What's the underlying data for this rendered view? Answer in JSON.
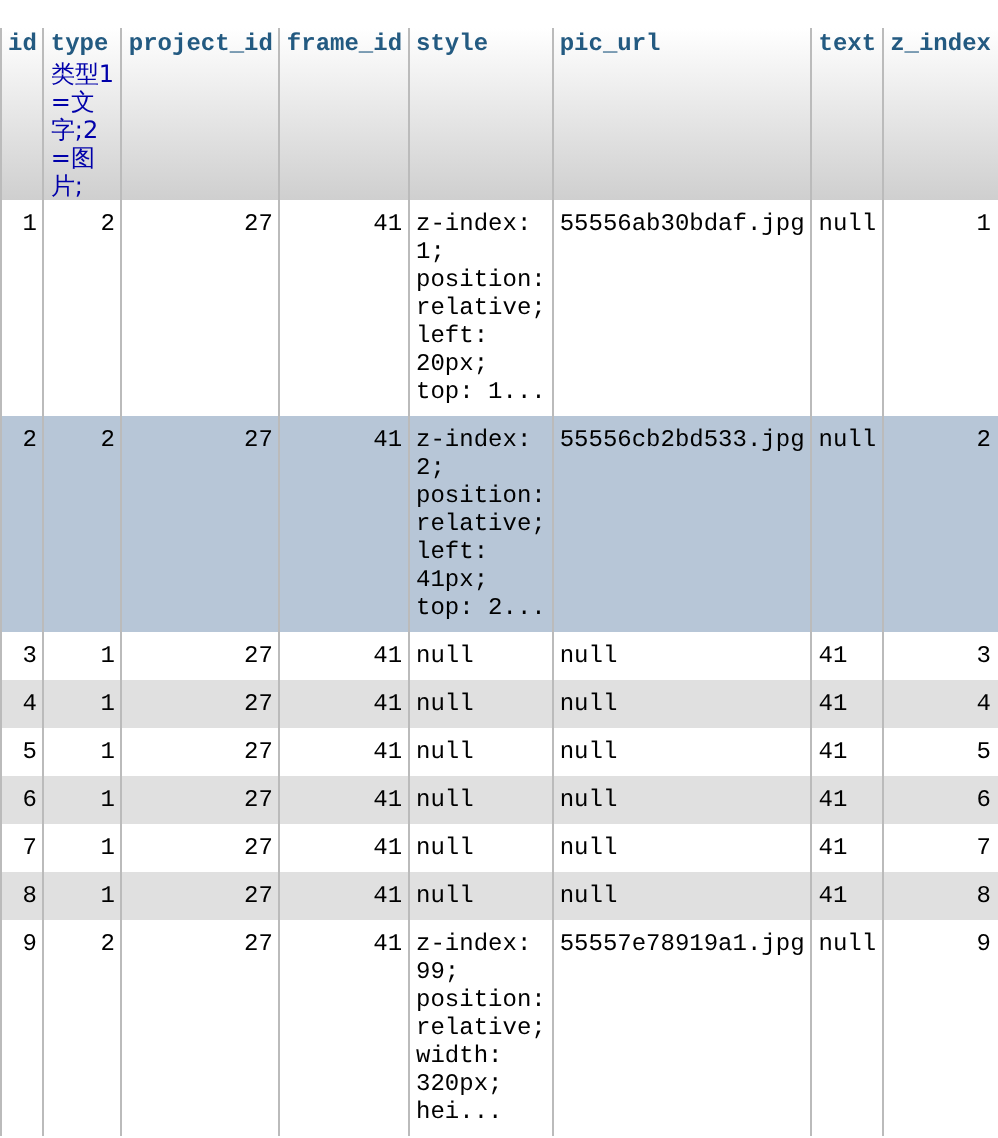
{
  "table": {
    "columns": [
      {
        "name": "id"
      },
      {
        "name": "type",
        "comment": "类型1=文字;2=图片;"
      },
      {
        "name": "project_id"
      },
      {
        "name": "frame_id"
      },
      {
        "name": "style"
      },
      {
        "name": "pic_url"
      },
      {
        "name": "text"
      },
      {
        "name": "z_index"
      }
    ],
    "rows": [
      {
        "selected": false,
        "cells": [
          "1",
          "2",
          "27",
          "41",
          "z-index: 1; position: relative; left: 20px; top: 1...",
          "55556ab30bdaf.jpg",
          "null",
          "1"
        ]
      },
      {
        "selected": true,
        "cells": [
          "2",
          "2",
          "27",
          "41",
          "z-index: 2; position: relative; left: 41px; top: 2...",
          "55556cb2bd533.jpg",
          "null",
          "2"
        ]
      },
      {
        "selected": false,
        "cells": [
          "3",
          "1",
          "27",
          "41",
          "null",
          "null",
          "41",
          "3"
        ]
      },
      {
        "selected": false,
        "cells": [
          "4",
          "1",
          "27",
          "41",
          "null",
          "null",
          "41",
          "4"
        ]
      },
      {
        "selected": false,
        "cells": [
          "5",
          "1",
          "27",
          "41",
          "null",
          "null",
          "41",
          "5"
        ]
      },
      {
        "selected": false,
        "cells": [
          "6",
          "1",
          "27",
          "41",
          "null",
          "null",
          "41",
          "6"
        ]
      },
      {
        "selected": false,
        "cells": [
          "7",
          "1",
          "27",
          "41",
          "null",
          "null",
          "41",
          "7"
        ]
      },
      {
        "selected": false,
        "cells": [
          "8",
          "1",
          "27",
          "41",
          "null",
          "null",
          "41",
          "8"
        ]
      },
      {
        "selected": false,
        "cells": [
          "9",
          "2",
          "27",
          "41",
          "z-index: 99; position: relative; width: 320px; hei...",
          "55557e78919a1.jpg",
          "null",
          "9"
        ]
      }
    ]
  }
}
